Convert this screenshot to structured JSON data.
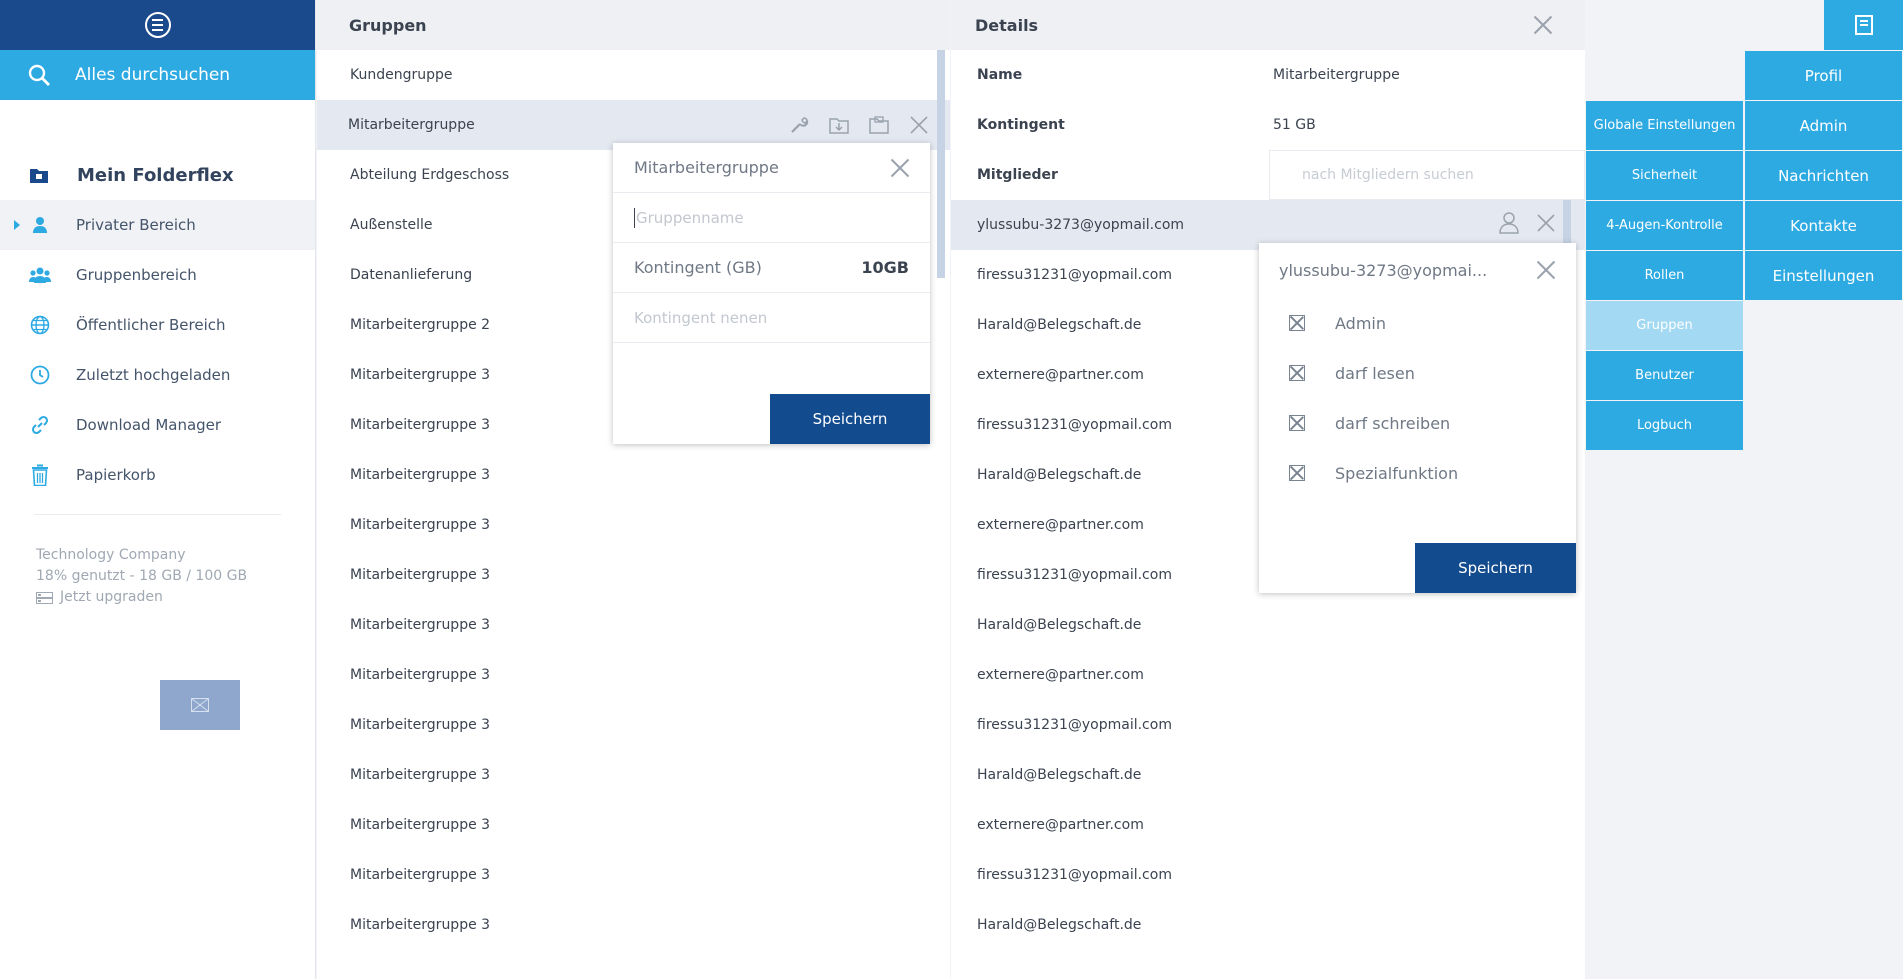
{
  "sidebar": {
    "search_label": "Alles durchsuchen",
    "brand": "Mein Folderflex",
    "items": [
      {
        "label": "Privater Bereich"
      },
      {
        "label": "Gruppenbereich"
      },
      {
        "label": "Öffentlicher Bereich"
      },
      {
        "label": "Zuletzt hochgeladen"
      },
      {
        "label": "Download Manager"
      },
      {
        "label": "Papierkorb"
      }
    ],
    "footer": {
      "company": "Technology Company",
      "usage": "18% genutzt - 18 GB / 100 GB",
      "upgrade": "Jetzt upgraden"
    }
  },
  "groups": {
    "title": "Gruppen",
    "rows": [
      "Kundengruppe",
      "Mitarbeitergruppe",
      "Abteilung Erdgeschoss",
      "Außenstelle",
      "Datenanlieferung",
      "Mitarbeitergruppe 2",
      "Mitarbeitergruppe 3",
      "Mitarbeitergruppe 3",
      "Mitarbeitergruppe 3",
      "Mitarbeitergruppe 3",
      "Mitarbeitergruppe 3",
      "Mitarbeitergruppe 3",
      "Mitarbeitergruppe 3",
      "Mitarbeitergruppe 3",
      "Mitarbeitergruppe 3",
      "Mitarbeitergruppe 3",
      "Mitarbeitergruppe 3",
      "Mitarbeitergruppe 3"
    ],
    "selected_index": 1
  },
  "group_popup": {
    "title": "Mitarbeitergruppe",
    "name_placeholder": "Gruppenname",
    "quota_label": "Kontingent (GB)",
    "quota_value": "10GB",
    "quota_placeholder": "Kontingent nenen",
    "save_label": "Speichern"
  },
  "details": {
    "title": "Details",
    "name_label": "Name",
    "name_value": "Mitarbeitergruppe",
    "quota_label": "Kontingent",
    "quota_value": "51 GB",
    "members_label": "Mitglieder",
    "members_search_placeholder": "nach Mitgliedern suchen",
    "members": [
      "ylussubu-3273@yopmail.com",
      "firessu31231@yopmail.com",
      "Harald@Belegschaft.de",
      "externere@partner.com",
      "firessu31231@yopmail.com",
      "Harald@Belegschaft.de",
      "externere@partner.com",
      "firessu31231@yopmail.com",
      "Harald@Belegschaft.de",
      "externere@partner.com",
      "firessu31231@yopmail.com",
      "Harald@Belegschaft.de",
      "externere@partner.com",
      "firessu31231@yopmail.com",
      "Harald@Belegschaft.de"
    ],
    "selected_index": 0
  },
  "member_popup": {
    "title": "ylussubu-3273@yopmai...",
    "permissions": [
      "Admin",
      "darf lesen",
      "darf schreiben",
      "Spezialfunktion"
    ],
    "save_label": "Speichern"
  },
  "right_menu": {
    "primary": [
      "Profil",
      "Admin",
      "Nachrichten",
      "Kontakte",
      "Einstellungen"
    ],
    "admin": [
      "Globale Einstellungen",
      "Sicherheit",
      "4-Augen-Kontrolle",
      "Rollen",
      "Gruppen",
      "Benutzer",
      "Logbuch"
    ],
    "active_admin": "Gruppen"
  },
  "colors": {
    "navy": "#1a4a8c",
    "accent": "#2eaae2",
    "active_menu": "#a3d9f2",
    "button": "#134b8f"
  }
}
